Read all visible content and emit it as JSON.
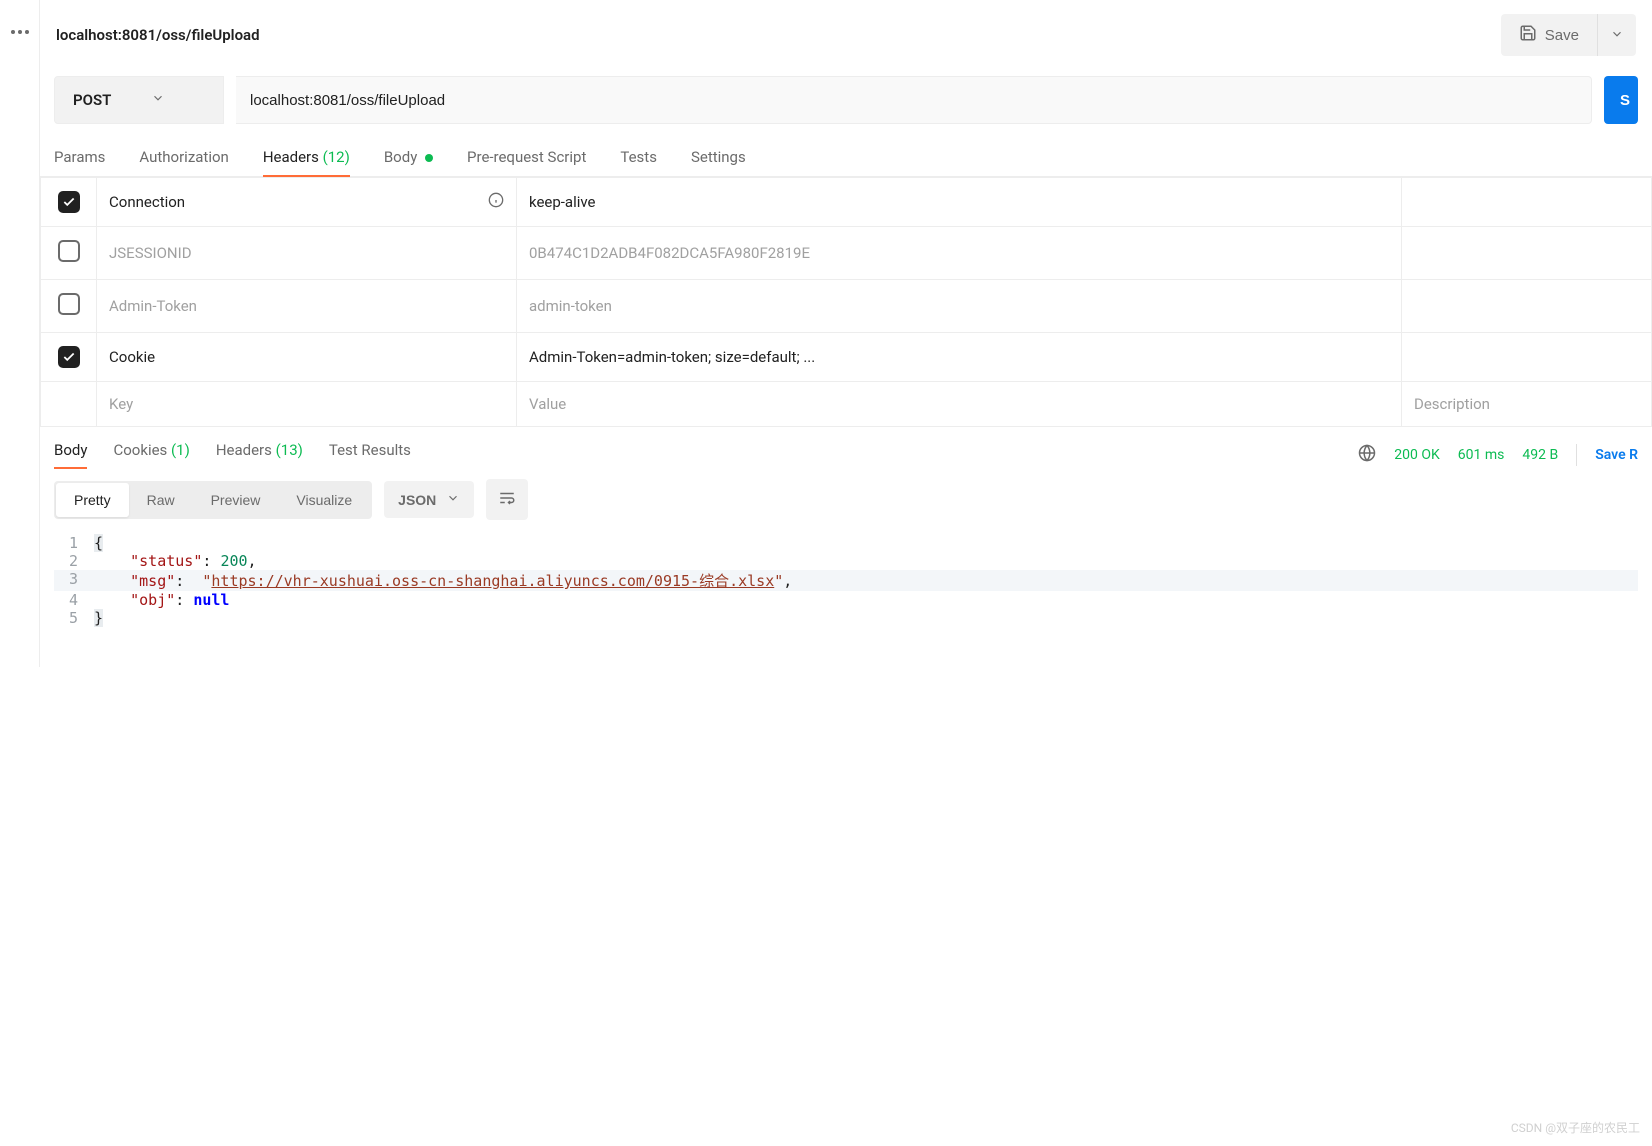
{
  "header": {
    "title": "localhost:8081/oss/fileUpload",
    "save_label": "Save"
  },
  "request": {
    "method": "POST",
    "url": "localhost:8081/oss/fileUpload",
    "send_label": "S"
  },
  "req_tabs": {
    "params": "Params",
    "auth": "Authorization",
    "headers_label": "Headers",
    "headers_count": "(12)",
    "body": "Body",
    "prereq": "Pre-request Script",
    "tests": "Tests",
    "settings": "Settings"
  },
  "headers_table": {
    "rows": [
      {
        "checked": true,
        "disabled": false,
        "key": "Connection",
        "value": "keep-alive",
        "info": true
      },
      {
        "checked": false,
        "disabled": true,
        "key": "JSESSIONID",
        "value": "0B474C1D2ADB4F082DCA5FA980F2819E"
      },
      {
        "checked": false,
        "disabled": true,
        "key": "Admin-Token",
        "value": "admin-token"
      },
      {
        "checked": true,
        "disabled": false,
        "key": "Cookie",
        "value": "Admin-Token=admin-token; size=default; ..."
      }
    ],
    "placeholder_key": "Key",
    "placeholder_value": "Value",
    "placeholder_desc": "Description"
  },
  "resp_tabs": {
    "body": "Body",
    "cookies_label": "Cookies",
    "cookies_count": "(1)",
    "headers_label": "Headers",
    "headers_count": "(13)",
    "tests": "Test Results"
  },
  "resp_meta": {
    "status": "200 OK",
    "time": "601 ms",
    "size": "492 B",
    "save": "Save R"
  },
  "format_row": {
    "pretty": "Pretty",
    "raw": "Raw",
    "preview": "Preview",
    "visualize": "Visualize",
    "lang": "JSON"
  },
  "response_body": {
    "status": 200,
    "msg": "https://vhr-xushuai.oss-cn-shanghai.aliyuncs.com/0915-综合.xlsx",
    "obj": null,
    "lines": {
      "l1": "{",
      "l5": "}"
    },
    "keys": {
      "status": "\"status\"",
      "msg": "\"msg\"",
      "obj": "\"obj\""
    },
    "vals": {
      "status": "200",
      "null": "null",
      "q": "\""
    }
  },
  "watermark": "CSDN @双子座的农民工"
}
